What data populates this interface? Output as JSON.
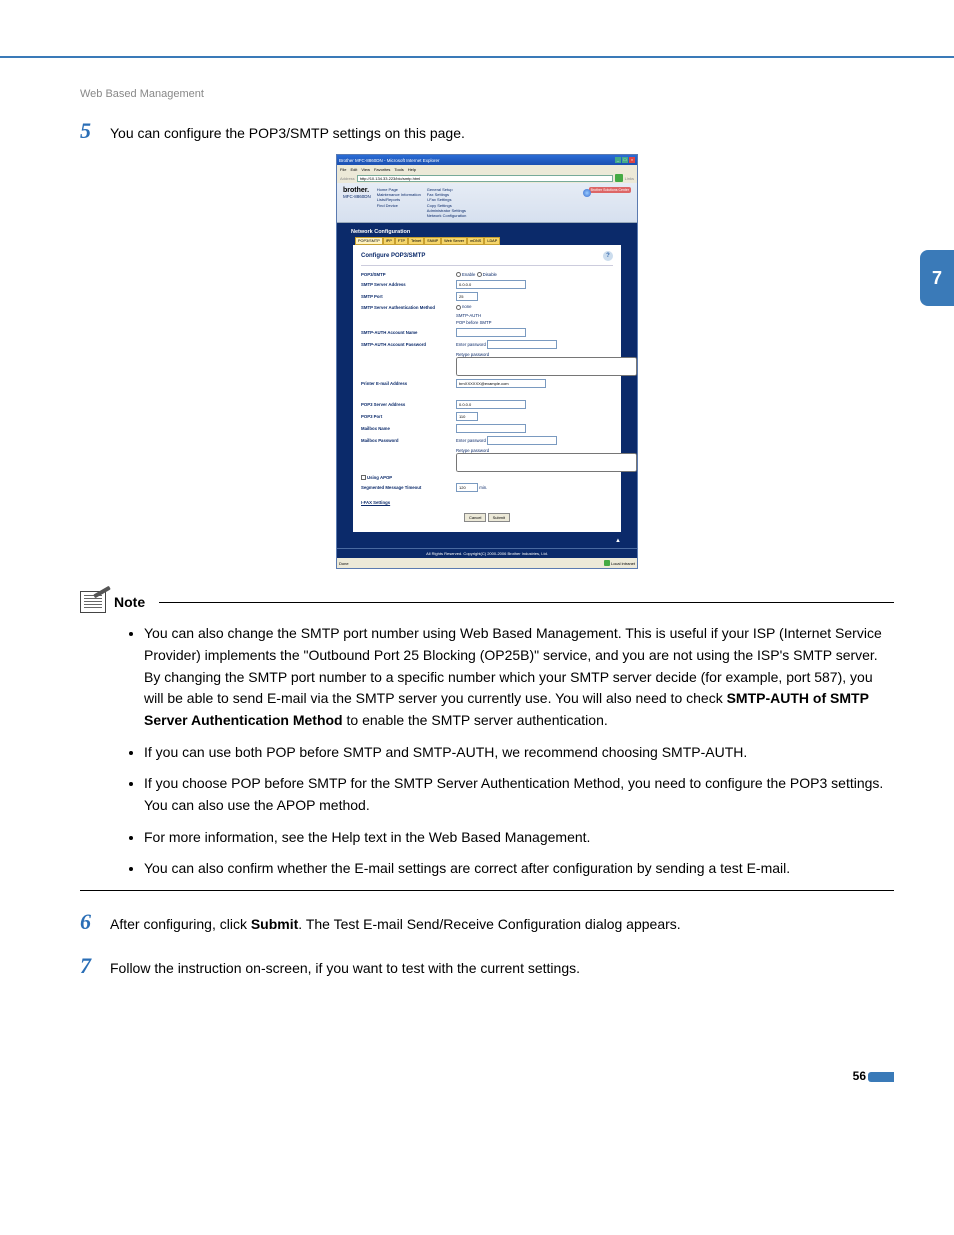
{
  "header": {
    "section": "Web Based Management"
  },
  "side_tab": "7",
  "steps": {
    "s5": {
      "num": "5",
      "text": "You can configure the POP3/SMTP settings on this page."
    },
    "s6": {
      "num": "6",
      "text_before": "After configuring, click ",
      "bold": "Submit",
      "text_after": ". The Test E-mail Send/Receive Configuration dialog appears."
    },
    "s7": {
      "num": "7",
      "text": "Follow the instruction on-screen, if you want to test with the current settings."
    }
  },
  "ie": {
    "title": "Brother MFC-8860DN - Microsoft Internet Explorer",
    "menus": [
      "File",
      "Edit",
      "View",
      "Favorites",
      "Tools",
      "Help"
    ],
    "addr_label": "Address",
    "addr_value": "http://10.134.33.223/bio/smtp.html",
    "links": "Links",
    "status_done": "Done",
    "status_zone": "Local intranet"
  },
  "topnav": {
    "logo": "brother.",
    "model": "MFC-8860DN",
    "col1": [
      "Home Page",
      "Maintenance Information",
      "Lists/Reports",
      "Find Device"
    ],
    "col2": [
      "General Setup",
      "Fax Settings",
      "I-Fax Settings",
      "Copy Settings",
      "Administrator Settings",
      "Network Configuration"
    ],
    "bsc": "Brother Solutions Center"
  },
  "nc": {
    "title": "Network Configuration",
    "tabs": [
      "POP3/SMTP",
      "IPP",
      "FTP",
      "Telnet",
      "SNMP",
      "Web Server",
      "mDNS",
      "LDAP"
    ]
  },
  "panel": {
    "title": "Configure POP3/SMTP",
    "rows": {
      "pop3smtp": "POP3/SMTP",
      "enable": "Enable",
      "disable": "Disable",
      "smtp_server": "SMTP Server Address",
      "smtp_server_v": "0.0.0.0",
      "smtp_port": "SMTP Port",
      "smtp_port_v": "25",
      "smtp_auth": "SMTP Server Authentication Method",
      "auth_none": "none",
      "auth_smtpauth": "SMTP-AUTH",
      "auth_pop": "POP before SMTP",
      "smtp_acc": "SMTP-AUTH Account Name",
      "smtp_pw": "SMTP-AUTH Account Password",
      "enter_pw": "Enter password",
      "retype_pw": "Retype password",
      "printer_email": "Printer E-mail Address",
      "printer_email_v": "brnXXXXXX@example.com",
      "pop3_server": "POP3 Server Address",
      "pop3_server_v": "0.0.0.0",
      "pop3_port": "POP3 Port",
      "pop3_port_v": "110",
      "mbox_name": "Mailbox Name",
      "mbox_pw": "Mailbox Password",
      "apop": "Using APOP",
      "seg_timeout": "Segmented Message Timeout",
      "seg_timeout_v": "120",
      "seg_unit": "min.",
      "ifax": "I-FAX Settings",
      "cancel": "Cancel",
      "submit": "Submit"
    },
    "copyright": "All Rights Reserved. Copyright(C) 2000-2006 Brother Industries, Ltd."
  },
  "note": {
    "title": "Note",
    "items": [
      {
        "pre": "You can also change the SMTP port number using Web Based Management. This is useful if your ISP (Internet Service Provider) implements the \"Outbound Port 25 Blocking (OP25B)\" service, and you are not using the ISP's SMTP server. By changing the SMTP port number to a specific number which your SMTP server decide (for example, port 587), you will be able to send E-mail via the SMTP server you currently use. You will also need to check ",
        "bold": "SMTP-AUTH of SMTP Server Authentication Method",
        "post": " to enable the SMTP server authentication."
      },
      {
        "pre": "If you can use both POP before SMTP and SMTP-AUTH, we recommend choosing SMTP-AUTH.",
        "bold": "",
        "post": ""
      },
      {
        "pre": "If you choose POP before SMTP for the SMTP Server Authentication Method, you need to configure the POP3 settings. You can also use the APOP method.",
        "bold": "",
        "post": ""
      },
      {
        "pre": "For more information, see the Help text in the Web Based Management.",
        "bold": "",
        "post": ""
      },
      {
        "pre": "You can also confirm whether the E-mail settings are correct after configuration by sending a test E-mail.",
        "bold": "",
        "post": ""
      }
    ]
  },
  "page_number": "56"
}
